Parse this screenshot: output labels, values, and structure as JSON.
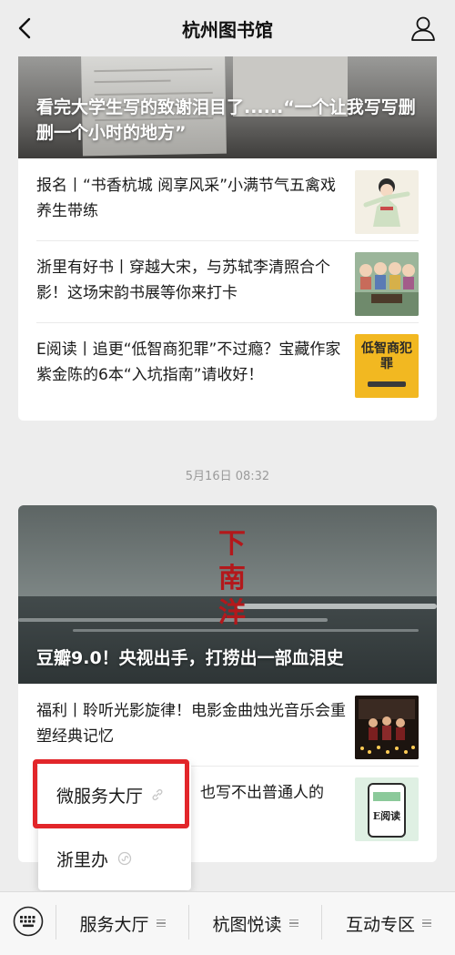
{
  "nav": {
    "title": "杭州图书馆",
    "back_icon": "chevron-left-icon",
    "profile_icon": "user-icon"
  },
  "card1": {
    "hero_title": "看完大学生写的致谢泪目了......“一个让我写写删删一个小时的地方”",
    "items": [
      {
        "text": "报名丨“书香杭城 阅享风采”小满节气五禽戏养生带练"
      },
      {
        "text": "浙里有好书丨穿越大宋，与苏轼李清照合个影！这场宋韵书展等你来打卡"
      },
      {
        "text": "E阅读丨追更“低智商犯罪”不过瘾？宝藏作家紫金陈的6本“入坑指南”请收好！"
      }
    ],
    "thumb3_title": "低智商犯罪"
  },
  "timestamp": "5月16日 08:32",
  "card2": {
    "hero_calligraphy": "下南洋",
    "hero_title": "豆瓣9.0！央视出手，打捞出一部血泪史",
    "items": [
      {
        "text": "福利丨聆听光影旋律！电影金曲烛光音乐会重塑经典记忆"
      },
      {
        "text": "也写不出普通人的"
      }
    ],
    "thumb2_label": "E阅读"
  },
  "popup": {
    "items": [
      {
        "label": "微服务大厅",
        "icon": "link-icon"
      },
      {
        "label": "浙里办",
        "icon": "mini-program-icon"
      }
    ]
  },
  "bottom_menu": {
    "keyboard_icon": "keyboard-icon",
    "items": [
      {
        "label": "服务大厅"
      },
      {
        "label": "杭图悦读"
      },
      {
        "label": "互动专区"
      }
    ]
  },
  "colors": {
    "background": "#ededed",
    "highlight": "#e2262a",
    "calligraphy": "#b3181b"
  }
}
